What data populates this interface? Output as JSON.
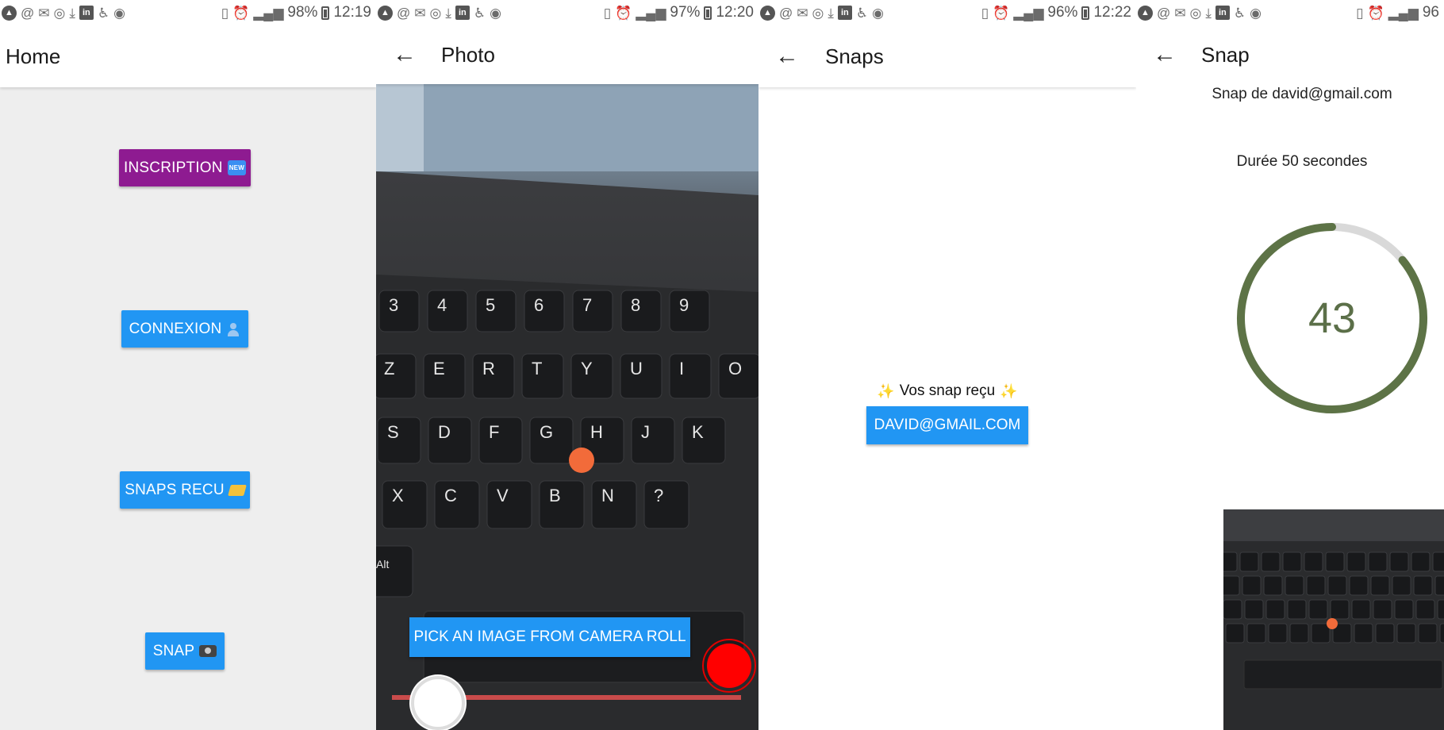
{
  "screens": {
    "home": {
      "status": {
        "battery": "98%",
        "time": "12:19"
      },
      "title": "Home",
      "buttons": {
        "inscription": {
          "label": "INSCRIPTION",
          "color": "#8e1b91",
          "badge": "NEW"
        },
        "connexion": {
          "label": "CONNEXION",
          "color": "#2196f3"
        },
        "snaps_recu": {
          "label": "SNAPS RECU",
          "color": "#2196f3"
        },
        "snap": {
          "label": "SNAP",
          "color": "#2196f3"
        }
      }
    },
    "photo": {
      "status": {
        "battery": "97%",
        "time": "12:20"
      },
      "title": "Photo",
      "pick_button": "PICK AN IMAGE FROM CAMERA ROLL",
      "keyboard_keys": [
        "3",
        "4",
        "5",
        "6",
        "7",
        "8",
        "9",
        "Z",
        "E",
        "R",
        "T",
        "Y",
        "U",
        "I",
        "O",
        "S",
        "D",
        "F",
        "G",
        "H",
        "J",
        "K",
        "X",
        "C",
        "V",
        "B",
        "N",
        "?",
        "Alt"
      ]
    },
    "snaps": {
      "status": {
        "battery": "96%",
        "time": "12:22"
      },
      "title": "Snaps",
      "list_label": "Vos snap reçu",
      "items": [
        {
          "email": "DAVID@GMAIL.COM"
        }
      ]
    },
    "snap": {
      "status": {
        "battery": "96"
      },
      "title": "Snap",
      "from_text": "Snap de david@gmail.com",
      "duration_text": "Durée 50 secondes",
      "countdown": 43,
      "countdown_total": 50,
      "ring_color": "#5d7346",
      "ring_track_color": "#d9d9d9"
    }
  },
  "icons": {
    "status_left": [
      "app-logo-icon",
      "at-icon",
      "gmail-icon",
      "chrome-icon",
      "download-icon",
      "linkedin-icon",
      "accessibility-icon",
      "hotspot-icon"
    ],
    "status_right": [
      "vibrate-icon",
      "alarm-icon",
      "4g-signal-icon",
      "battery-icon"
    ]
  }
}
